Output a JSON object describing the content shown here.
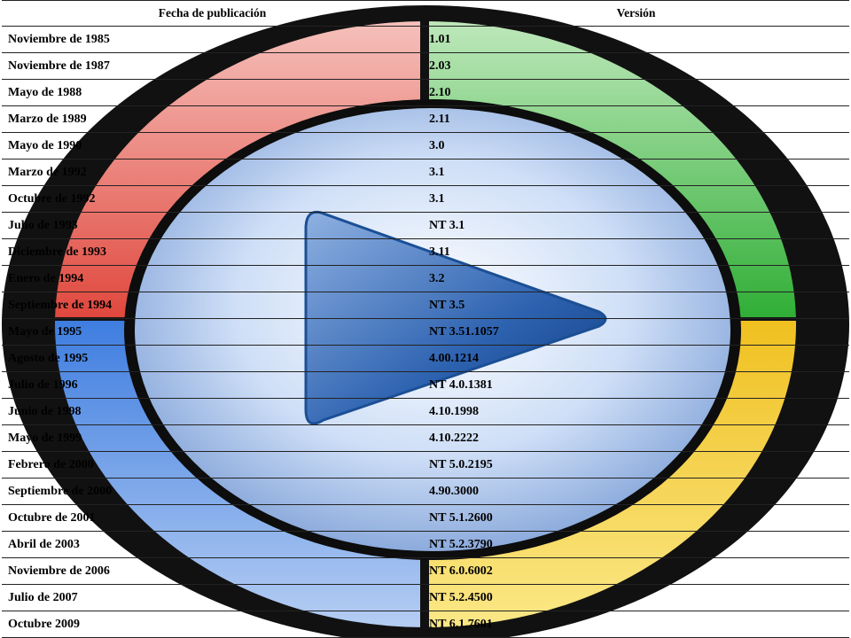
{
  "table": {
    "headers": [
      "Fecha de publicación",
      "Versión"
    ],
    "rows": [
      [
        "Noviembre de 1985",
        "1.01"
      ],
      [
        "Noviembre de 1987",
        "2.03"
      ],
      [
        "Mayo de 1988",
        "2.10"
      ],
      [
        "Marzo de 1989",
        "2.11"
      ],
      [
        "Mayo de 1990",
        "3.0"
      ],
      [
        "Marzo de 1992",
        "3.1"
      ],
      [
        "Octubre de 1992",
        "3.1"
      ],
      [
        "Julio de 1993",
        "NT 3.1"
      ],
      [
        "Diciembre de 1993",
        "3.11"
      ],
      [
        "Enero de 1994",
        "3.2"
      ],
      [
        "Septiembre de 1994",
        "NT 3.5"
      ],
      [
        "Mayo de 1995",
        "NT 3.51.1057"
      ],
      [
        "Agosto de 1995",
        "4.00.1214"
      ],
      [
        "Julio de 1996",
        "NT 4.0.1381"
      ],
      [
        "Junio de 1998",
        "4.10.1998"
      ],
      [
        "Mayo de 1999",
        "4.10.2222"
      ],
      [
        "Febrero de 2000",
        "NT 5.0.2195"
      ],
      [
        "Septiembre de 2000",
        "4.90.3000"
      ],
      [
        "Octubre de 2001",
        "NT 5.1.2600"
      ],
      [
        "Abril de 2003",
        "NT 5.2.3790"
      ],
      [
        "Noviembre de 2006",
        "NT 6.0.6002"
      ],
      [
        "Julio de 2007",
        "NT 5.2.4500"
      ],
      [
        "Octubre 2009",
        "NT 6.1.7601"
      ]
    ]
  },
  "background": {
    "icon": "media-player-logo",
    "colors": {
      "ring": "#111111",
      "red": "#e8544a",
      "green": "#3fb53f",
      "blue": "#3e7de0",
      "yellow": "#f0c020",
      "play": "#1f5fa8"
    }
  }
}
